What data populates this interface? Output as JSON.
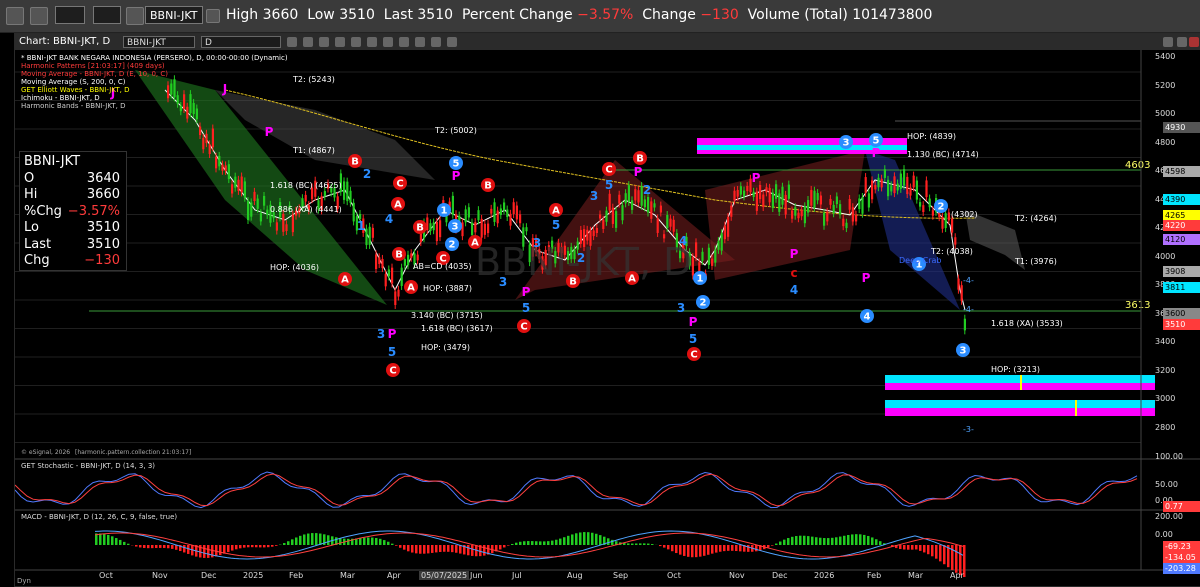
{
  "toolbar": {
    "symbol": "BBNI-JKT",
    "quote": {
      "high_label": "High",
      "high": "3660",
      "low_label": "Low",
      "low": "3510",
      "last_label": "Last",
      "last": "3510",
      "pct_label": "Percent Change",
      "pct": "−3.57%",
      "chg_label": "Change",
      "chg": "−130",
      "vol_label": "Volume (Total)",
      "vol": "101473800"
    }
  },
  "chart": {
    "title": "Chart: BBNI-JKT, D",
    "symbol_field": "BBNI-JKT",
    "interval_field": "D",
    "watermark": "BBNI-JKT, D",
    "copyright": "© eSignal, 2026",
    "pattern_ts": "[harmonic.pattern.collection 21:03:17]",
    "legend": [
      "* BBNI-JKT BANK NEGARA INDONESIA (PERSERO), D, 00:00-00:00 (Dynamic)",
      "Harmonic Patterns [21:03:17] (409 days)",
      "Moving Average - BBNI-JKT, D (E, 10, 0, C)",
      "Moving Average (S, 200, 0, C)",
      "GET Elliott Waves - BBNI-JKT, D",
      "Ichimoku - BBNI-JKT, D",
      "Harmonic Bands - BBNI-JKT, D"
    ],
    "legend_colors": [
      "#ffffff",
      "#ff3b3b",
      "#ff3b3b",
      "#ffffff",
      "#ffff00",
      "#ffffff",
      "#cccccc"
    ],
    "ohlc": [
      {
        "k": "BBNI-JKT",
        "v": ""
      },
      {
        "k": "O",
        "v": "3640"
      },
      {
        "k": "Hi",
        "v": "3660"
      },
      {
        "k": "%Chg",
        "v": "−3.57%"
      },
      {
        "k": "Lo",
        "v": "3510"
      },
      {
        "k": "Last",
        "v": "3510"
      },
      {
        "k": "Chg",
        "v": "−130"
      }
    ],
    "right_axis": [
      "5400",
      "5200",
      "5000",
      "4800",
      "4600",
      "4400",
      "4200",
      "4000",
      "3800",
      "3600",
      "3400",
      "3200",
      "3000",
      "2800"
    ],
    "price_tags": [
      {
        "t": "4930",
        "bg": "#555555",
        "fg": "#ffffff"
      },
      {
        "t": "4598",
        "bg": "#aaaaaa",
        "fg": "#000000"
      },
      {
        "t": "4390",
        "bg": "#00e5ff",
        "fg": "#000000"
      },
      {
        "t": "4265",
        "bg": "#ffff00",
        "fg": "#000000"
      },
      {
        "t": "4220",
        "bg": "#ff3b3b",
        "fg": "#ffffff"
      },
      {
        "t": "4120",
        "bg": "#b070ff",
        "fg": "#000000"
      },
      {
        "t": "3908",
        "bg": "#aaaaaa",
        "fg": "#000000"
      },
      {
        "t": "3811",
        "bg": "#00e5ff",
        "fg": "#000000"
      },
      {
        "t": "3600",
        "bg": "#888888",
        "fg": "#000000"
      },
      {
        "t": "3510",
        "bg": "#ff3b3b",
        "fg": "#ffffff"
      }
    ],
    "levels": {
      "l4603": "4603",
      "l3613": "3613",
      "t2_5243": "T2: (5243)",
      "t2_5002": "T2: (5002)",
      "t1_4867": "T1: (4867)",
      "fib1618_4625": "1.618 (BC) (4625)",
      "fib0886_4441": "0.886 (XA) (4441)",
      "hop_4036": "HOP: (4036)",
      "ab_cd_4035": "AB=CD (4035)",
      "hop_3887": "HOP: (3887)",
      "fib3140_3715": "3.140 (BC) (3715)",
      "fib1618_3617": "1.618 (BC) (3617)",
      "hop_3479": "HOP: (3479)",
      "hop_4839": "HOP: (4839)",
      "fib1130_4714": "1.130 (BC) (4714)",
      "v4302": "(4302)",
      "t2_4264": "T2: (4264)",
      "t2_4038": "T2: (4038)",
      "t1_3976": "T1: (3976)",
      "deep_crab": "Deep Crab",
      "fib1618_3533": "1.618 (XA) (3533)",
      "hop_3213": "HOP: (3213)",
      "wave_3": "-3-",
      "wave_4": "-4-"
    },
    "months": [
      "Oct",
      "Nov",
      "Dec",
      "2025",
      "Feb",
      "Mar",
      "Apr",
      "05/07/2025",
      "Jun",
      "Jul",
      "Aug",
      "Sep",
      "Oct",
      "Nov",
      "Dec",
      "2026",
      "Feb",
      "Mar",
      "Apr"
    ],
    "stoch": {
      "title": "GET Stochastic - BBNI-JKT, D (14, 3, 3)",
      "axis": [
        "100.00",
        "50.00",
        "0.00"
      ],
      "tag": "0.77"
    },
    "macd": {
      "title": "MACD - BBNI-JKT, D (12, 26, C, 9, false, true)",
      "axis": [
        "200.00",
        "0.00"
      ],
      "tags": [
        "-69.23",
        "-134.05",
        "-203.28"
      ]
    },
    "footer": "Dyn"
  },
  "colors": {
    "up": "#22cc22",
    "down": "#ff2020",
    "accent_cyan": "#00e5ff",
    "accent_magenta": "#ff00ff",
    "ma_yellow": "#e0c020"
  }
}
